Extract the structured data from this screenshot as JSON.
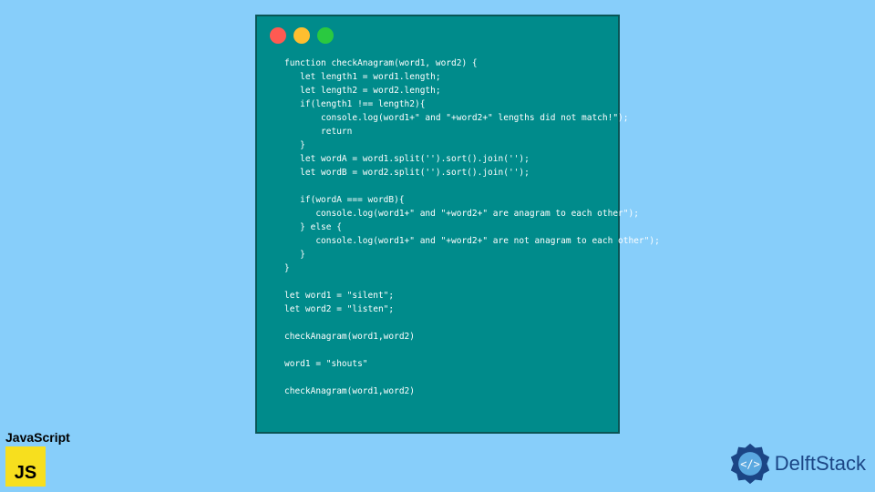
{
  "window": {
    "controls": [
      "red",
      "yellow",
      "green"
    ],
    "code": "function checkAnagram(word1, word2) {\n   let length1 = word1.length;\n   let length2 = word2.length;\n   if(length1 !== length2){\n       console.log(word1+\" and \"+word2+\" lengths did not match!\");\n       return\n   }\n   let wordA = word1.split('').sort().join('');\n   let wordB = word2.split('').sort().join('');\n\n   if(wordA === wordB){\n      console.log(word1+\" and \"+word2+\" are anagram to each other\");\n   } else {\n      console.log(word1+\" and \"+word2+\" are not anagram to each other\");\n   }\n}\n\nlet word1 = \"silent\";\nlet word2 = \"listen\";\n\ncheckAnagram(word1,word2)\n\nword1 = \"shouts\"\n\ncheckAnagram(word1,word2)"
  },
  "js_badge": {
    "label": "JavaScript",
    "logo_text": "JS"
  },
  "delft": {
    "text": "DelftStack"
  }
}
